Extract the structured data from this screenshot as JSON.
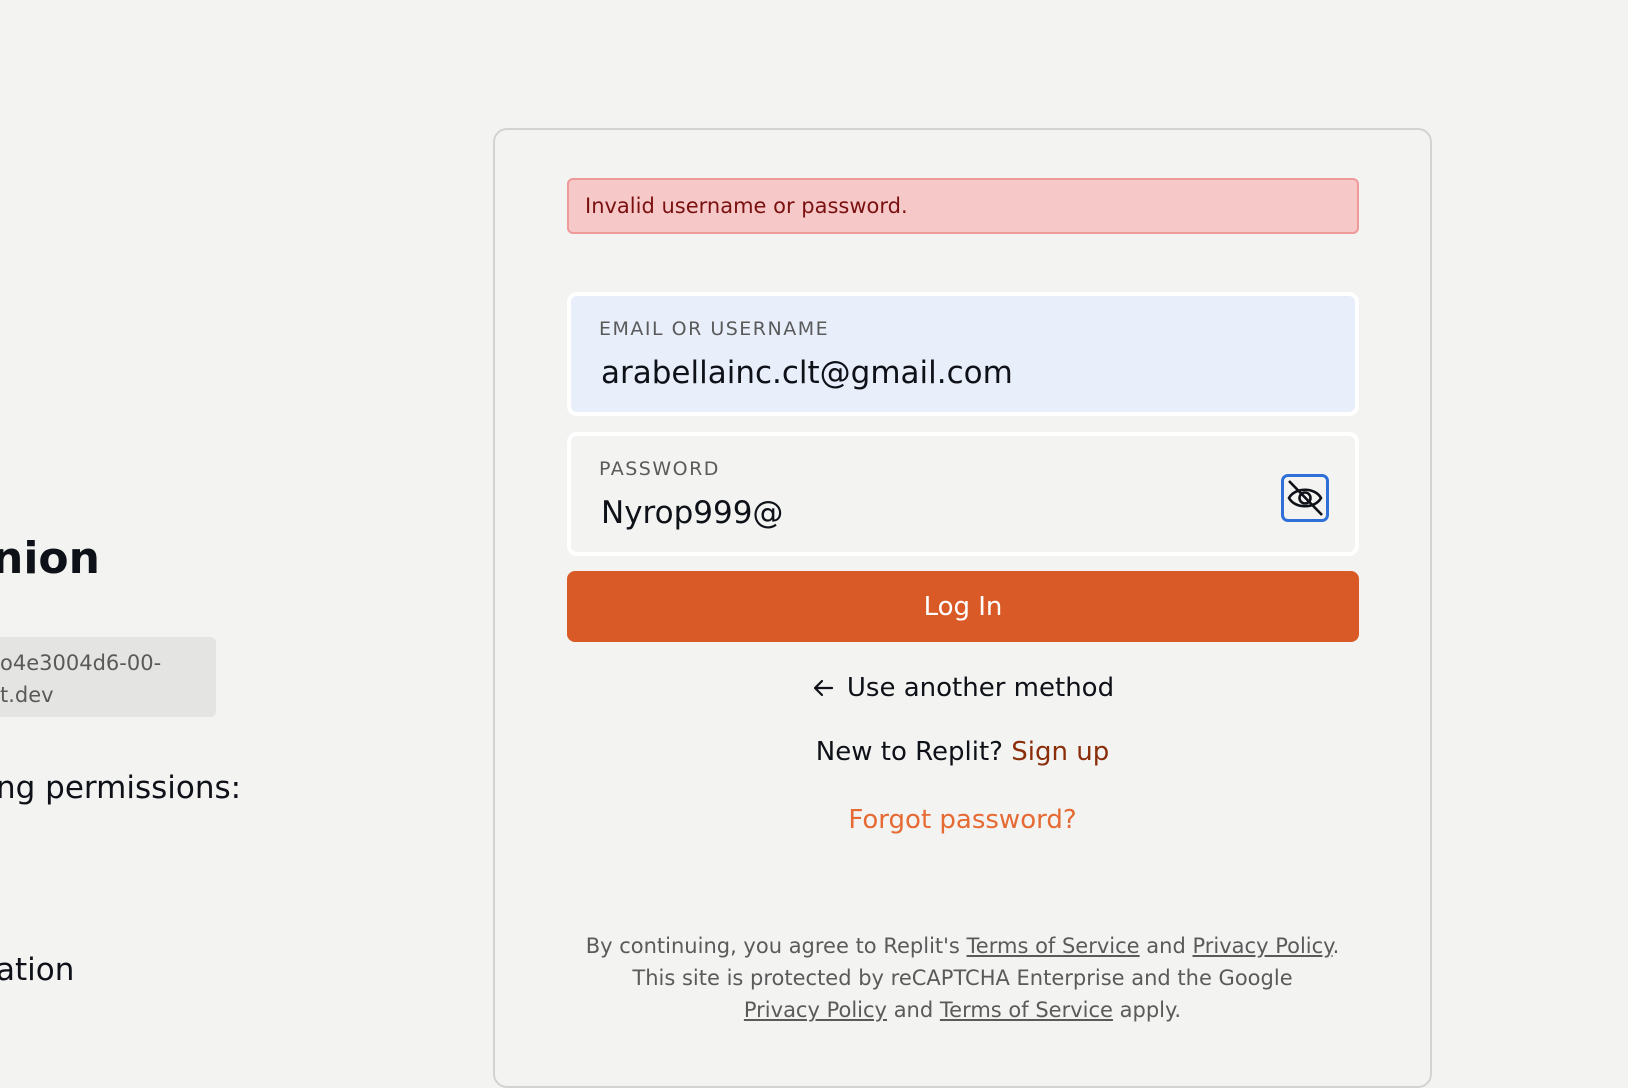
{
  "background_page": {
    "app_name": "nion",
    "domain_line1": "o4e3004d6-00-",
    "domain_line2": "t.dev",
    "permissions_heading": "ng permissions:",
    "permission_item": "ation"
  },
  "login_card": {
    "error_message": "Invalid username or password.",
    "email_field": {
      "label": "EMAIL OR USERNAME",
      "value": "arabellainc.clt@gmail.com"
    },
    "password_field": {
      "label": "PASSWORD",
      "value": "Nyrop999@",
      "visibility_icon": "eye-slash-icon"
    },
    "login_button": "Log In",
    "another_method": "Use another method",
    "new_user_text": "New to Replit?",
    "signup_link": "Sign up",
    "forgot_password": "Forgot password?",
    "legal": {
      "part1": "By continuing, you agree to Replit's",
      "terms1": "Terms of Service",
      "and1": "and",
      "privacy1": "Privacy Policy",
      "period": ".",
      "part2": "This site is protected by reCAPTCHA Enterprise and the Google",
      "privacy2": "Privacy Policy",
      "and2": "and",
      "terms2": "Terms of Service",
      "apply": "apply."
    }
  },
  "colors": {
    "primary": "#d95a27",
    "error_bg": "#f6c8c8",
    "link_orange": "#e66a33",
    "focus_blue": "#2f6fd8"
  }
}
